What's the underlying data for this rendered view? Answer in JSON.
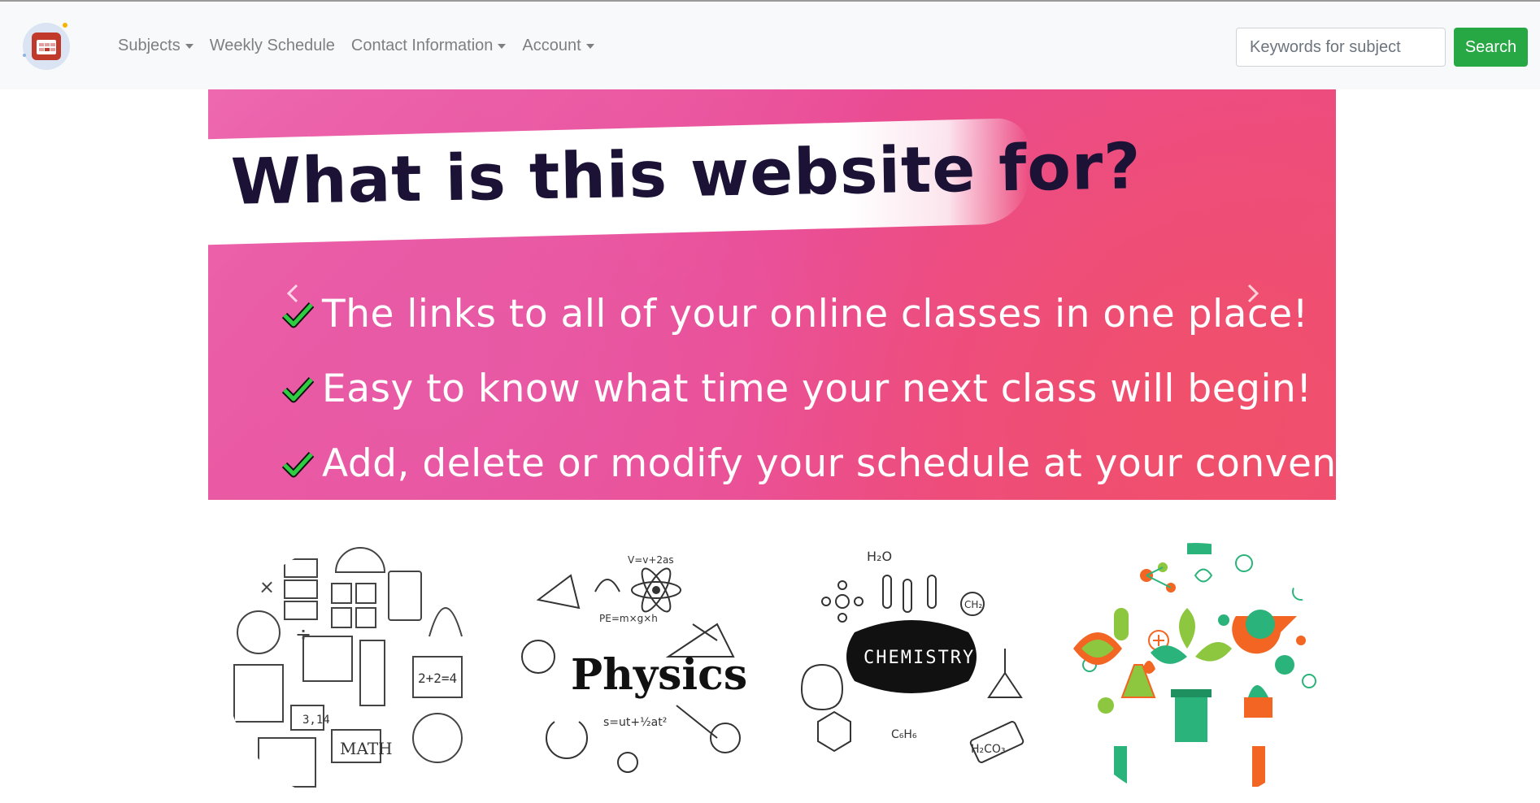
{
  "navbar": {
    "logo_icon": "calendar-icon",
    "links": [
      {
        "label": "Subjects",
        "dropdown": true
      },
      {
        "label": "Weekly Schedule",
        "dropdown": false
      },
      {
        "label": "Contact Information",
        "dropdown": true
      },
      {
        "label": "Account",
        "dropdown": true
      }
    ],
    "search": {
      "placeholder": "Keywords for subject",
      "value": "",
      "button_label": "Search"
    }
  },
  "carousel": {
    "headline": "What is this website for?",
    "items": [
      "The links to all of your online classes in one place!",
      "Easy to know what time your next class will begin!",
      "Add, delete or modify your schedule at your convenience!"
    ],
    "controls": {
      "prev_icon": "chevron-left-icon",
      "next_icon": "chevron-right-icon"
    }
  },
  "subjects": [
    {
      "name": "math",
      "label": "MATH",
      "icon": "math-collage-icon"
    },
    {
      "name": "physics",
      "label": "Physics",
      "icon": "physics-collage-icon"
    },
    {
      "name": "chemistry",
      "label": "CHEMISTRY",
      "icon": "chemistry-collage-icon"
    },
    {
      "name": "biology",
      "label": "",
      "icon": "biology-collage-icon"
    }
  ],
  "colors": {
    "accent_green": "#28a745",
    "navbar_bg": "#f8f9fa",
    "banner_pink": "#ea4c94",
    "headline_dark": "#1b1236"
  }
}
